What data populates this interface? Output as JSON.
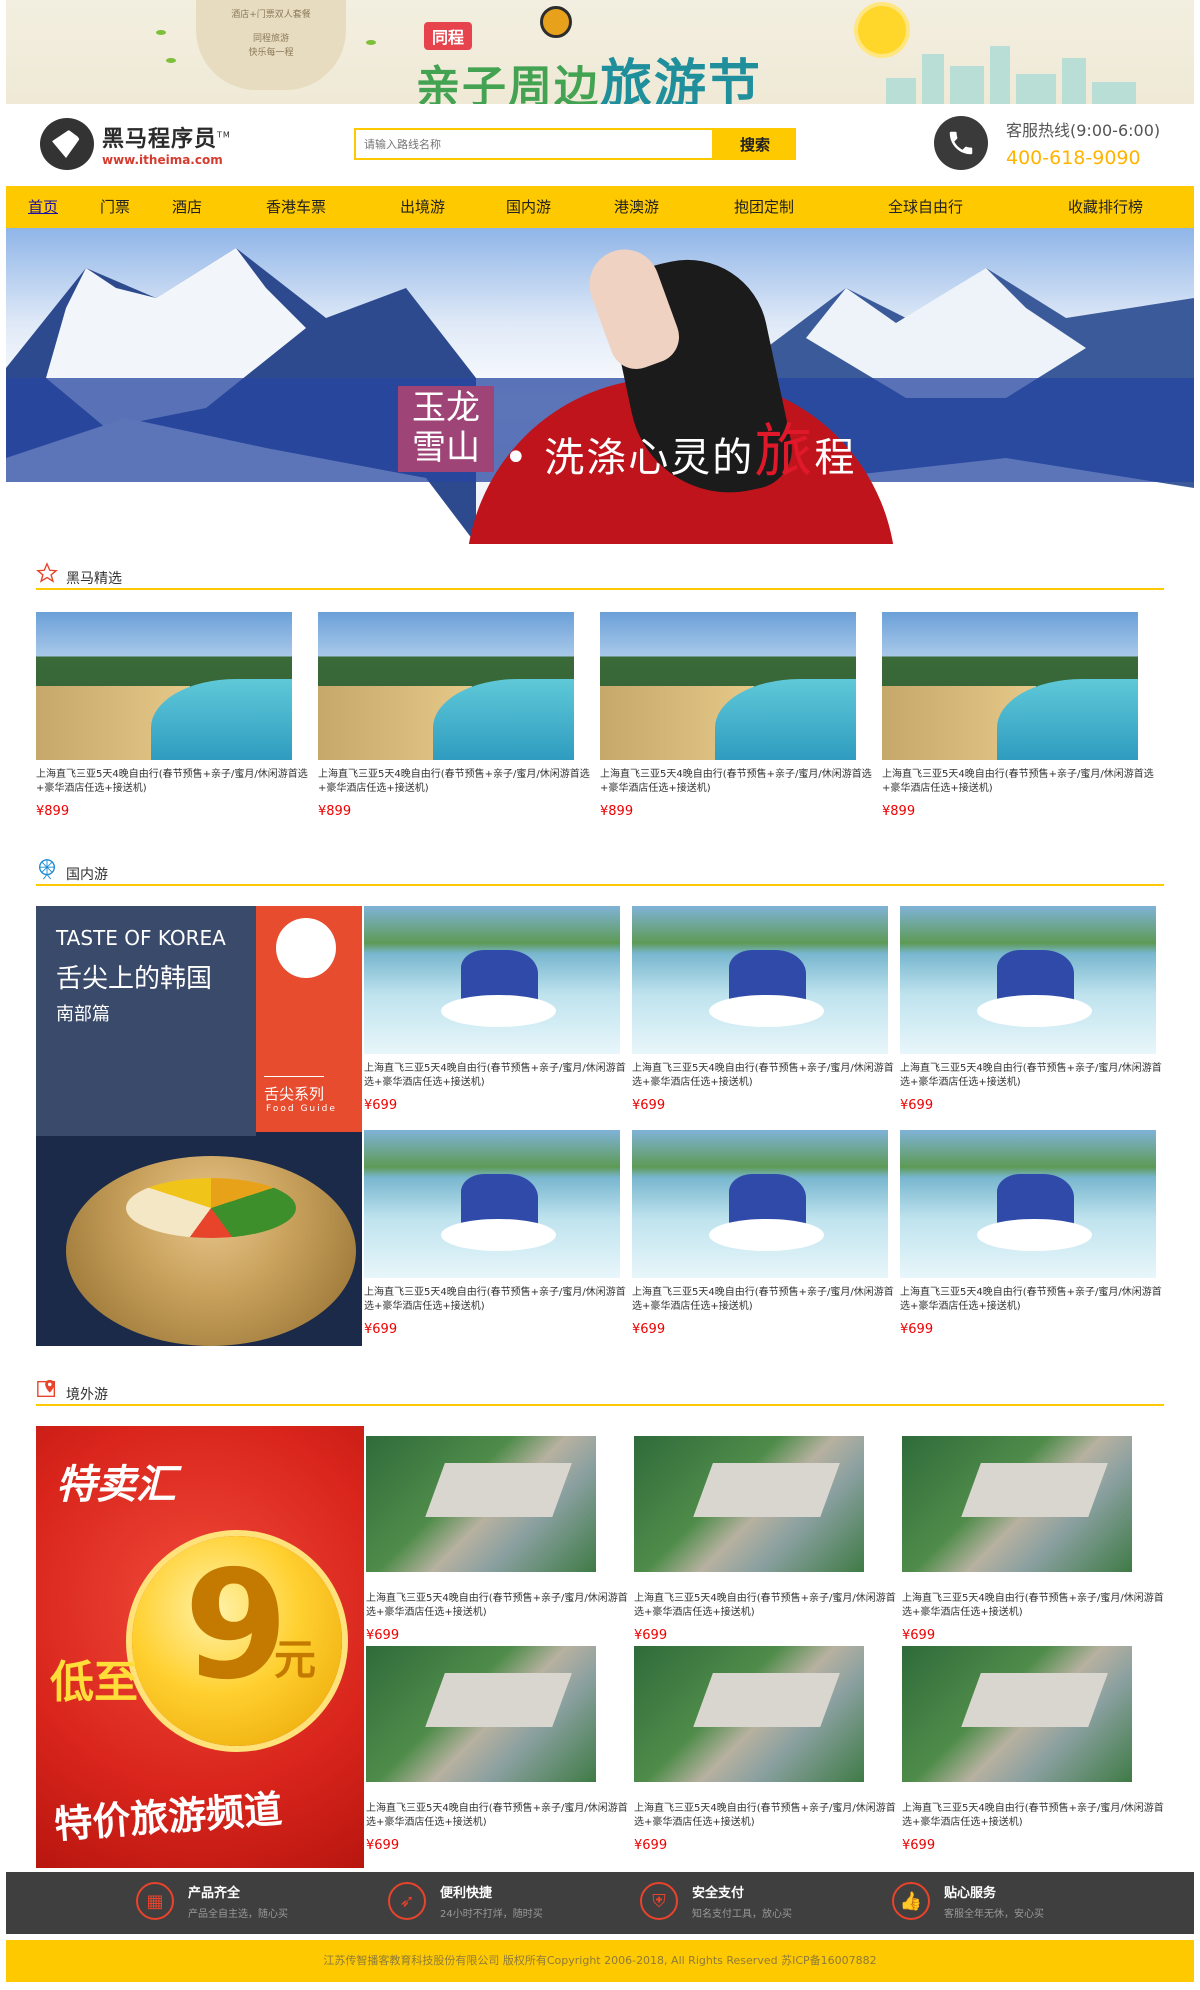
{
  "top_banner": {
    "card_lines": [
      "酒店+门票双人套餐",
      "同程旅游",
      "快乐每一程"
    ],
    "brand": "同程",
    "festival_text": "亲子周边",
    "festival_big": "旅游节"
  },
  "header": {
    "logo_cn": "黑马程序员",
    "logo_tm": "TM",
    "logo_url": "www.itheima.com",
    "search_placeholder": "请输入路线名称",
    "search_button": "搜索",
    "hotline_label": "客服热线(9:00-6:00)",
    "hotline_number": "400-618-9090"
  },
  "nav": {
    "items": [
      "首页",
      "门票",
      "酒店",
      "香港车票",
      "出境游",
      "国内游",
      "港澳游",
      "抱团定制",
      "全球自由行",
      "收藏排行榜"
    ]
  },
  "hero": {
    "stamp_top": "玉龙",
    "stamp_bottom": "雪山",
    "slogan": "• 洗涤心灵的",
    "slogan_red": "旅",
    "slogan_end": "程"
  },
  "sections": {
    "featured": {
      "title": "黑马精选",
      "items": [
        {
          "title": "上海直飞三亚5天4晚自由行(春节预售+亲子/蜜月/休闲游首选+豪华酒店任选+接送机)",
          "price": "¥899"
        },
        {
          "title": "上海直飞三亚5天4晚自由行(春节预售+亲子/蜜月/休闲游首选+豪华酒店任选+接送机)",
          "price": "¥899"
        },
        {
          "title": "上海直飞三亚5天4晚自由行(春节预售+亲子/蜜月/休闲游首选+豪华酒店任选+接送机)",
          "price": "¥899"
        },
        {
          "title": "上海直飞三亚5天4晚自由行(春节预售+亲子/蜜月/休闲游首选+豪华酒店任选+接送机)",
          "price": "¥899"
        }
      ]
    },
    "domestic": {
      "title": "国内游",
      "promo": {
        "en": "TASTE OF KOREA",
        "cn1": "舌尖上的韩国",
        "cn2": "南部篇",
        "series": "舌尖系列",
        "series_en": "Food Guide"
      },
      "items": [
        {
          "title": "上海直飞三亚5天4晚自由行(春节预售+亲子/蜜月/休闲游首选+豪华酒店任选+接送机)",
          "price": "¥699"
        },
        {
          "title": "上海直飞三亚5天4晚自由行(春节预售+亲子/蜜月/休闲游首选+豪华酒店任选+接送机)",
          "price": "¥699"
        },
        {
          "title": "上海直飞三亚5天4晚自由行(春节预售+亲子/蜜月/休闲游首选+豪华酒店任选+接送机)",
          "price": "¥699"
        },
        {
          "title": "上海直飞三亚5天4晚自由行(春节预售+亲子/蜜月/休闲游首选+豪华酒店任选+接送机)",
          "price": "¥699"
        },
        {
          "title": "上海直飞三亚5天4晚自由行(春节预售+亲子/蜜月/休闲游首选+豪华酒店任选+接送机)",
          "price": "¥699"
        },
        {
          "title": "上海直飞三亚5天4晚自由行(春节预售+亲子/蜜月/休闲游首选+豪华酒店任选+接送机)",
          "price": "¥699"
        }
      ]
    },
    "abroad": {
      "title": "境外游",
      "promo": {
        "brand": "特卖汇",
        "low": "低至",
        "num": "9",
        "unit": "元",
        "channel": "特价旅游频道"
      },
      "items": [
        {
          "title": "上海直飞三亚5天4晚自由行(春节预售+亲子/蜜月/休闲游首选+豪华酒店任选+接送机)",
          "price": "¥699"
        },
        {
          "title": "上海直飞三亚5天4晚自由行(春节预售+亲子/蜜月/休闲游首选+豪华酒店任选+接送机)",
          "price": "¥699"
        },
        {
          "title": "上海直飞三亚5天4晚自由行(春节预售+亲子/蜜月/休闲游首选+豪华酒店任选+接送机)",
          "price": "¥699"
        },
        {
          "title": "上海直飞三亚5天4晚自由行(春节预售+亲子/蜜月/休闲游首选+豪华酒店任选+接送机)",
          "price": "¥699"
        },
        {
          "title": "上海直飞三亚5天4晚自由行(春节预售+亲子/蜜月/休闲游首选+豪华酒店任选+接送机)",
          "price": "¥699"
        },
        {
          "title": "上海直飞三亚5天4晚自由行(春节预售+亲子/蜜月/休闲游首选+豪华酒店任选+接送机)",
          "price": "¥699"
        }
      ]
    }
  },
  "features": [
    {
      "icon": "grid-icon",
      "title": "产品齐全",
      "sub": "产品全自主选，随心买"
    },
    {
      "icon": "rocket-icon",
      "title": "便利快捷",
      "sub": "24小时不打烊，随时买"
    },
    {
      "icon": "shield-icon",
      "title": "安全支付",
      "sub": "知名支付工具，放心买"
    },
    {
      "icon": "thumbs-up-icon",
      "title": "贴心服务",
      "sub": "客服全年无休，安心买"
    }
  ],
  "footer": {
    "copyright": "江苏传智播客教育科技股份有限公司 版权所有Copyright 2006-2018, All Rights Reserved 苏ICP备16007882"
  },
  "colors": {
    "accent": "#ffc900",
    "price": "#e00000",
    "dark_strip": "#3f3f3f"
  }
}
